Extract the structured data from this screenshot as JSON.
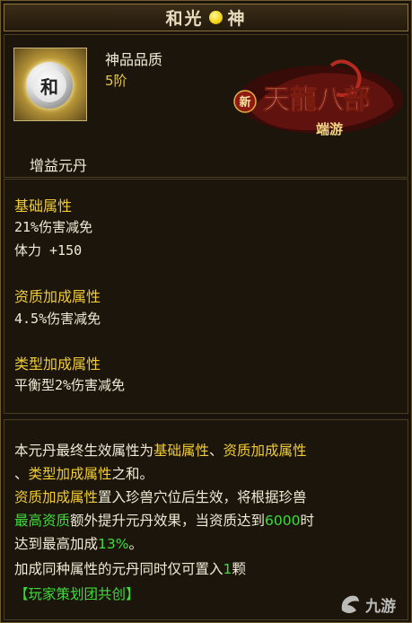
{
  "title": {
    "left": "和光",
    "right": "神"
  },
  "header": {
    "icon_char": "和",
    "quality_label": "神品品质",
    "quality_value": "5阶",
    "item_type": "增益元丹",
    "logo": {
      "new": "新",
      "name": "天龍八部",
      "sub": "端游"
    }
  },
  "attributes": {
    "base": {
      "title": "基础属性",
      "lines": [
        "21%伤害减免",
        "体力 +150"
      ]
    },
    "aptitude": {
      "title": "资质加成属性",
      "lines": [
        "4.5%伤害减免"
      ]
    },
    "type": {
      "title": "类型加成属性",
      "lines": [
        "平衡型2%伤害减免"
      ]
    }
  },
  "description": {
    "l1": {
      "a": "本元丹最终生效属性为",
      "b": "基础属性",
      "c": "、",
      "d": "资质加成属性"
    },
    "l2": {
      "a": "、",
      "b": "类型加成属性",
      "c": "之和。"
    },
    "l3": {
      "a": "资质加成属性",
      "b": "置入珍兽穴位后生效，将根据珍兽"
    },
    "l4": {
      "a": "最高资质",
      "b": "额外提升元丹效果，当资质达到",
      "c": "6000",
      "d": "时"
    },
    "l5": {
      "a": "达到最高加成",
      "b": "13%",
      "c": "。"
    },
    "l6": {
      "a": "加成同种属性的元丹同时仅可置入",
      "b": "1",
      "c": "颗"
    },
    "promo": "【玩家策划团共创】"
  },
  "watermark": "九游",
  "colors": {
    "yellow": "#f0cc35",
    "green": "#3fdc3a",
    "border": "#6e5a2f"
  }
}
